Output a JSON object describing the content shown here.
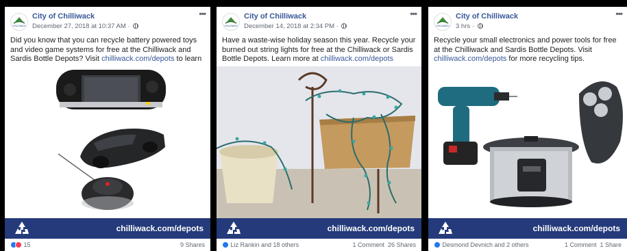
{
  "posts": [
    {
      "page_name": "City of Chilliwack",
      "timestamp": "December 27, 2018 at 10:37 AM",
      "text_before": "Did you know that you can recycle battery powered toys and video game systems for free at the Chilliwack and Sardis Bottle Depots? Visit ",
      "link": "chilliwack.com/depots",
      "text_after": " to learn more.",
      "banner": "chilliwack.com/depots",
      "reaction_count": "15",
      "comments": "",
      "shares": "9 Shares",
      "reaction_icons": [
        "like-icon",
        "love-icon"
      ]
    },
    {
      "page_name": "City of Chilliwack",
      "timestamp": "December 14, 2018 at 2:34 PM",
      "text_before": "Have a waste-wise holiday season this year. Recycle your burned out string lights for free at the Chilliwack or Sardis Bottle Depots. Learn more at ",
      "link": "chilliwack.com/depots",
      "text_after": "",
      "banner": "chilliwack.com/depots",
      "reaction_count": "Liz Rankin and 18 others",
      "comments": "1 Comment",
      "shares": "26 Shares",
      "reaction_icons": [
        "like-icon"
      ]
    },
    {
      "page_name": "City of Chilliwack",
      "timestamp": "3 hrs",
      "text_before": "Recycle your small electronics and power tools for free at the Chilliwack and Sardis Bottle Depots. Visit ",
      "link": "chilliwack.com/depots",
      "text_after": " for more recycling tips.",
      "banner": "chilliwack.com/depots",
      "reaction_count": "Desmond Devnich and 2 others",
      "comments": "1 Comment",
      "shares": "1 Share",
      "reaction_icons": [
        "like-icon"
      ]
    }
  ],
  "avatar_text": "CHILLIWACK",
  "more_glyph": "•••",
  "colors": {
    "link": "#385898",
    "banner": "#243a7a",
    "like": "#2078f4",
    "love": "#f33e58"
  }
}
